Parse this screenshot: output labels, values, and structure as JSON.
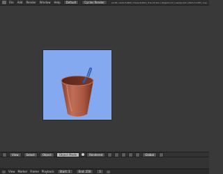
{
  "topbar": {
    "menus": [
      "File",
      "Add",
      "Render",
      "Window",
      "Help"
    ],
    "screen": "Default",
    "engine": "Cycles Render",
    "stats": "v2.68 | Verts:6,800 | Faces:6,656 | Tris:13,312 | Objects:1/3 | Lamps:0/1 | Mem:3.27M | Cup"
  },
  "viewport_header": {
    "editor_type": "View",
    "menus": [
      "View",
      "Select",
      "Object"
    ],
    "mode": "Object Mode",
    "shading": "Rendered",
    "global": "Global"
  },
  "timeline": {
    "menus": [
      "View",
      "Marker",
      "Frame",
      "Playback"
    ],
    "start_label": "Start: 1",
    "end_label": "End: 250",
    "current_frame": "1"
  },
  "colors": {
    "background": "#393939",
    "render_sky": "#84a9f0",
    "cup": "#b0604b",
    "straw": "#3d6fc2"
  }
}
